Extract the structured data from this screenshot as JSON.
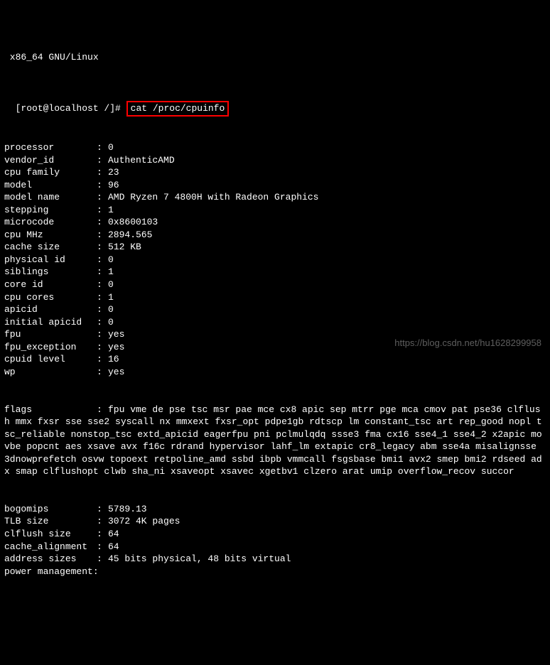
{
  "header_line": " x86_64 GNU/Linux",
  "prompt": {
    "text": "[root@localhost /]#",
    "command": "cat /proc/cpuinfo"
  },
  "rows": [
    {
      "k": "processor",
      "v": "0"
    },
    {
      "k": "vendor_id",
      "v": "AuthenticAMD"
    },
    {
      "k": "cpu family",
      "v": "23"
    },
    {
      "k": "model",
      "v": "96"
    },
    {
      "k": "model name",
      "v": "AMD Ryzen 7 4800H with Radeon Graphics"
    },
    {
      "k": "stepping",
      "v": "1"
    },
    {
      "k": "microcode",
      "v": "0x8600103"
    },
    {
      "k": "cpu MHz",
      "v": "2894.565"
    },
    {
      "k": "cache size",
      "v": "512 KB"
    },
    {
      "k": "physical id",
      "v": "0"
    },
    {
      "k": "siblings",
      "v": "1"
    },
    {
      "k": "core id",
      "v": "0"
    },
    {
      "k": "cpu cores",
      "v": "1"
    },
    {
      "k": "apicid",
      "v": "0"
    },
    {
      "k": "initial apicid",
      "v": "0"
    },
    {
      "k": "fpu",
      "v": "yes"
    },
    {
      "k": "fpu_exception",
      "v": "yes"
    },
    {
      "k": "cpuid level",
      "v": "16"
    },
    {
      "k": "wp",
      "v": "yes"
    }
  ],
  "flags_key": "flags",
  "flags_value": "fpu vme de pse tsc msr pae mce cx8 apic sep mtrr pge mca cmov pat pse36 clflush mmx fxsr sse sse2 syscall nx mmxext fxsr_opt pdpe1gb rdtscp lm constant_tsc art rep_good nopl tsc_reliable nonstop_tsc extd_apicid eagerfpu pni pclmulqdq ssse3 fma cx16 sse4_1 sse4_2 x2apic movbe popcnt aes xsave avx f16c rdrand hypervisor lahf_lm extapic cr8_legacy abm sse4a misalignsse 3dnowprefetch osvw topoext retpoline_amd ssbd ibpb vmmcall fsgsbase bmi1 avx2 smep bmi2 rdseed adx smap clflushopt clwb sha_ni xsaveopt xsavec xgetbv1 clzero arat umip overflow_recov succor",
  "rows2": [
    {
      "k": "bogomips",
      "v": "5789.13"
    },
    {
      "k": "TLB size",
      "v": "3072 4K pages"
    },
    {
      "k": "clflush size",
      "v": "64"
    },
    {
      "k": "cache_alignment",
      "v": "64"
    },
    {
      "k": "address sizes",
      "v": "45 bits physical, 48 bits virtual"
    },
    {
      "k": "power management:",
      "v": ""
    }
  ],
  "watermark": "https://blog.csdn.net/hu1628299958"
}
